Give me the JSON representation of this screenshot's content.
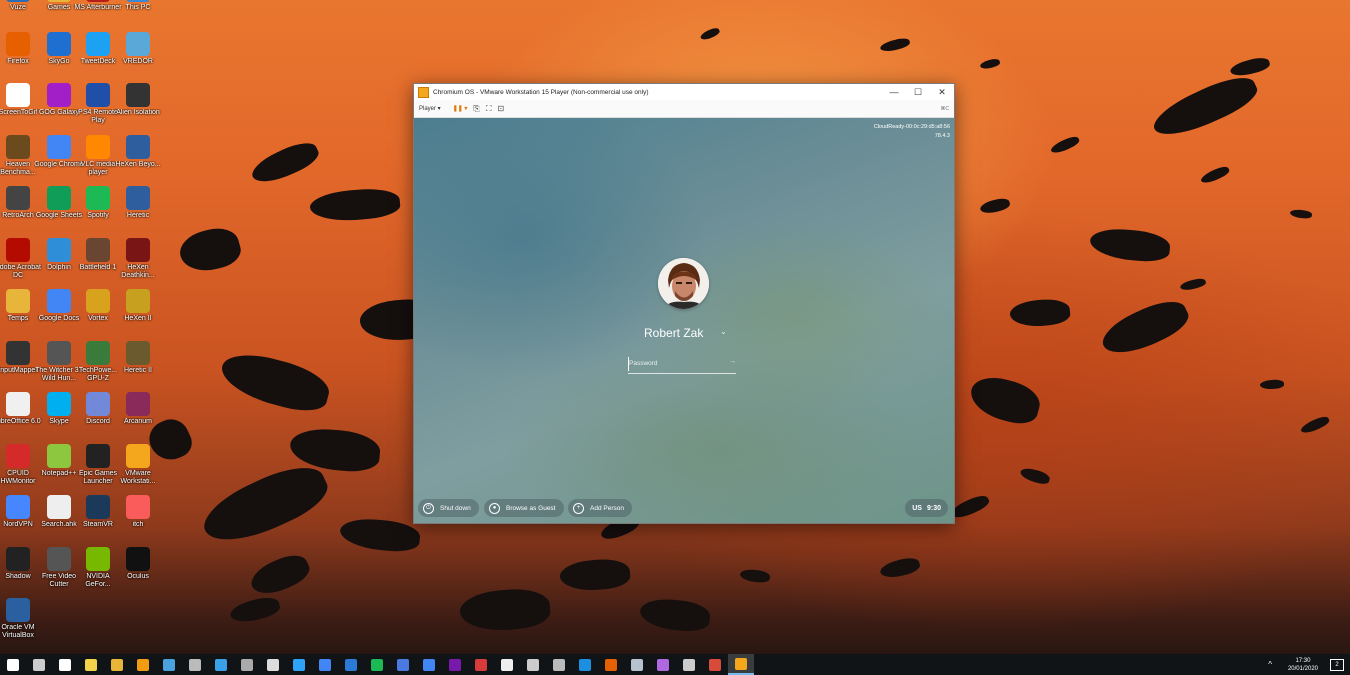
{
  "desktop": {
    "icons": [
      {
        "label": "Vuze",
        "icon": "vuze-icon",
        "color": "#2a6db5"
      },
      {
        "label": "Games",
        "icon": "games-folder-icon",
        "color": "#e8b53b"
      },
      {
        "label": "MS Afterburner",
        "icon": "afterburner-icon",
        "color": "#b51d1d"
      },
      {
        "label": "This PC",
        "icon": "this-pc-icon",
        "color": "#3b88d6"
      },
      {
        "label": "Firefox",
        "icon": "firefox-icon",
        "color": "#e66000"
      },
      {
        "label": "SkyGo",
        "icon": "sky-icon",
        "color": "#1f6fd0"
      },
      {
        "label": "TweetDeck",
        "icon": "twitter-icon",
        "color": "#1da1f2"
      },
      {
        "label": "VREDOR",
        "icon": "vredor-icon",
        "color": "#5aa8d8"
      },
      {
        "label": "ScreenToGif",
        "icon": "screentogif-icon",
        "color": "#ffffff"
      },
      {
        "label": "GOG Galaxy",
        "icon": "gog-icon",
        "color": "#a21ec7"
      },
      {
        "label": "PS4 Remote Play",
        "icon": "ps4-remote-icon",
        "color": "#1f4fa8"
      },
      {
        "label": "Alien Isolation",
        "icon": "alien-icon",
        "color": "#333333"
      },
      {
        "label": "Heaven Benchma...",
        "icon": "heaven-icon",
        "color": "#6b4a1e"
      },
      {
        "label": "Google Chrome",
        "icon": "chrome-icon",
        "color": "#4285f4"
      },
      {
        "label": "VLC media player",
        "icon": "vlc-icon",
        "color": "#ff8800"
      },
      {
        "label": "HeXen Beyo...",
        "icon": "hexen-icon",
        "color": "#2e5e9e"
      },
      {
        "label": "RetroArch",
        "icon": "retroarch-icon",
        "color": "#444444"
      },
      {
        "label": "Google Sheets",
        "icon": "sheets-icon",
        "color": "#0f9d58"
      },
      {
        "label": "Spotify",
        "icon": "spotify-icon",
        "color": "#1db954"
      },
      {
        "label": "Heretic",
        "icon": "heretic-icon",
        "color": "#2e5e9e"
      },
      {
        "label": "Adobe Acrobat DC",
        "icon": "acrobat-icon",
        "color": "#b30b00"
      },
      {
        "label": "Dolphin",
        "icon": "dolphin-icon",
        "color": "#2f8ed8"
      },
      {
        "label": "Battlefield 1",
        "icon": "battlefield-icon",
        "color": "#6a4632"
      },
      {
        "label": "HeXen Deathkin...",
        "icon": "hexen-deathkings-icon",
        "color": "#7a1515"
      },
      {
        "label": "Temps",
        "icon": "folder-icon",
        "color": "#e8b53b"
      },
      {
        "label": "Google Docs",
        "icon": "docs-icon",
        "color": "#4285f4"
      },
      {
        "label": "Vortex",
        "icon": "vortex-icon",
        "color": "#d8a21c"
      },
      {
        "label": "HeXen II",
        "icon": "hexen2-icon",
        "color": "#c8a020"
      },
      {
        "label": "InputMapper",
        "icon": "inputmapper-icon",
        "color": "#333333"
      },
      {
        "label": "The Witcher 3 - Wild Hun...",
        "icon": "witcher-icon",
        "color": "#555555"
      },
      {
        "label": "TechPowe... GPU-Z",
        "icon": "gpuz-icon",
        "color": "#3a7a3a"
      },
      {
        "label": "Heretic II",
        "icon": "heretic2-icon",
        "color": "#6b5a2e"
      },
      {
        "label": "LibreOffice 6.0",
        "icon": "libreoffice-icon",
        "color": "#f0f0f0"
      },
      {
        "label": "Skype",
        "icon": "skype-icon",
        "color": "#00aff0"
      },
      {
        "label": "Discord",
        "icon": "discord-icon",
        "color": "#7289da"
      },
      {
        "label": "Arcanum",
        "icon": "arcanum-icon",
        "color": "#8a2a5a"
      },
      {
        "label": "CPUID HWMonitor",
        "icon": "hwmonitor-icon",
        "color": "#d42a2a"
      },
      {
        "label": "Notepad++",
        "icon": "notepadpp-icon",
        "color": "#8dc63f"
      },
      {
        "label": "Epic Games Launcher",
        "icon": "epic-icon",
        "color": "#222222"
      },
      {
        "label": "VMware Workstati...",
        "icon": "vmware-icon",
        "color": "#f4a71d"
      },
      {
        "label": "NordVPN",
        "icon": "nordvpn-icon",
        "color": "#4687ff"
      },
      {
        "label": "Search.ahk",
        "icon": "ahk-icon",
        "color": "#eeeeee"
      },
      {
        "label": "SteamVR",
        "icon": "steamvr-icon",
        "color": "#1b3a5a"
      },
      {
        "label": "itch",
        "icon": "itch-icon",
        "color": "#fa5c5c"
      },
      {
        "label": "Shadow",
        "icon": "shadow-icon",
        "color": "#222222"
      },
      {
        "label": "Free Video Cutter",
        "icon": "video-cutter-icon",
        "color": "#555555"
      },
      {
        "label": "NVIDIA GeFor...",
        "icon": "nvidia-icon",
        "color": "#76b900"
      },
      {
        "label": "Oculus",
        "icon": "oculus-icon",
        "color": "#111111"
      },
      {
        "label": "Oracle VM VirtualBox",
        "icon": "virtualbox-icon",
        "color": "#2a5fa0"
      }
    ]
  },
  "window": {
    "title": "Chromium OS - VMware Workstation 15 Player (Non-commercial use only)",
    "minimize": "—",
    "maximize": "☐",
    "close": "✕",
    "toolbar": {
      "player_label": "Player ▾",
      "pause_icon": "❚❚ ▾",
      "hotkey_hint": "⌘C"
    }
  },
  "chromeos": {
    "device_id": "CloudReady-00:0c:29:d5:a8:56",
    "version": "78.4.3",
    "user_name": "Robert Zak",
    "password_placeholder": "Password",
    "shutdown_label": "Shut down",
    "guest_label": "Browse as Guest",
    "add_person_label": "Add Person",
    "keyboard_layout": "US",
    "time": "9:30"
  },
  "taskbar": {
    "items": [
      {
        "icon": "windows-start-icon",
        "color": "#ffffff"
      },
      {
        "icon": "task-view-icon",
        "color": "#cccccc"
      },
      {
        "icon": "settings-gear-icon",
        "color": "#ffffff"
      },
      {
        "icon": "sticky-notes-icon",
        "color": "#f2d34b"
      },
      {
        "icon": "file-explorer-icon",
        "color": "#e8b53b"
      },
      {
        "icon": "search-icon",
        "color": "#f39c12"
      },
      {
        "icon": "mail-send-icon",
        "color": "#4aa3df"
      },
      {
        "icon": "mail-icon",
        "color": "#bbbbbb"
      },
      {
        "icon": "store-icon",
        "color": "#3aa0e8"
      },
      {
        "icon": "photos-icon",
        "color": "#aaaaaa"
      },
      {
        "icon": "gamepad-icon",
        "color": "#dddddd"
      },
      {
        "icon": "photoshop-icon",
        "color": "#2fa3f7"
      },
      {
        "icon": "chrome-icon",
        "color": "#4285f4"
      },
      {
        "icon": "edge-icon",
        "color": "#2a7ad8"
      },
      {
        "icon": "spotify-icon",
        "color": "#1db954"
      },
      {
        "icon": "messages-icon",
        "color": "#4a7ae0"
      },
      {
        "icon": "docs-icon",
        "color": "#4285f4"
      },
      {
        "icon": "onenote-icon",
        "color": "#7719aa"
      },
      {
        "icon": "acrobat-icon",
        "color": "#d83b3b"
      },
      {
        "icon": "media-icon",
        "color": "#eeeeee"
      },
      {
        "icon": "xbox-icon",
        "color": "#cccccc"
      },
      {
        "icon": "epic-games-icon",
        "color": "#bbbbbb"
      },
      {
        "icon": "sync-icon",
        "color": "#1d8fe0"
      },
      {
        "icon": "firefox-icon",
        "color": "#e66000"
      },
      {
        "icon": "steam-icon",
        "color": "#b7c2cf"
      },
      {
        "icon": "podcast-icon",
        "color": "#b068e0"
      },
      {
        "icon": "gamepad-alt-icon",
        "color": "#cccccc"
      },
      {
        "icon": "chrome-alt-icon",
        "color": "#d84a3a"
      },
      {
        "icon": "vmware-icon",
        "color": "#f4a71d"
      }
    ],
    "clock_time": "17:30",
    "clock_date": "20/01/2020",
    "notification_count": "2",
    "tray_chevron": "^"
  }
}
